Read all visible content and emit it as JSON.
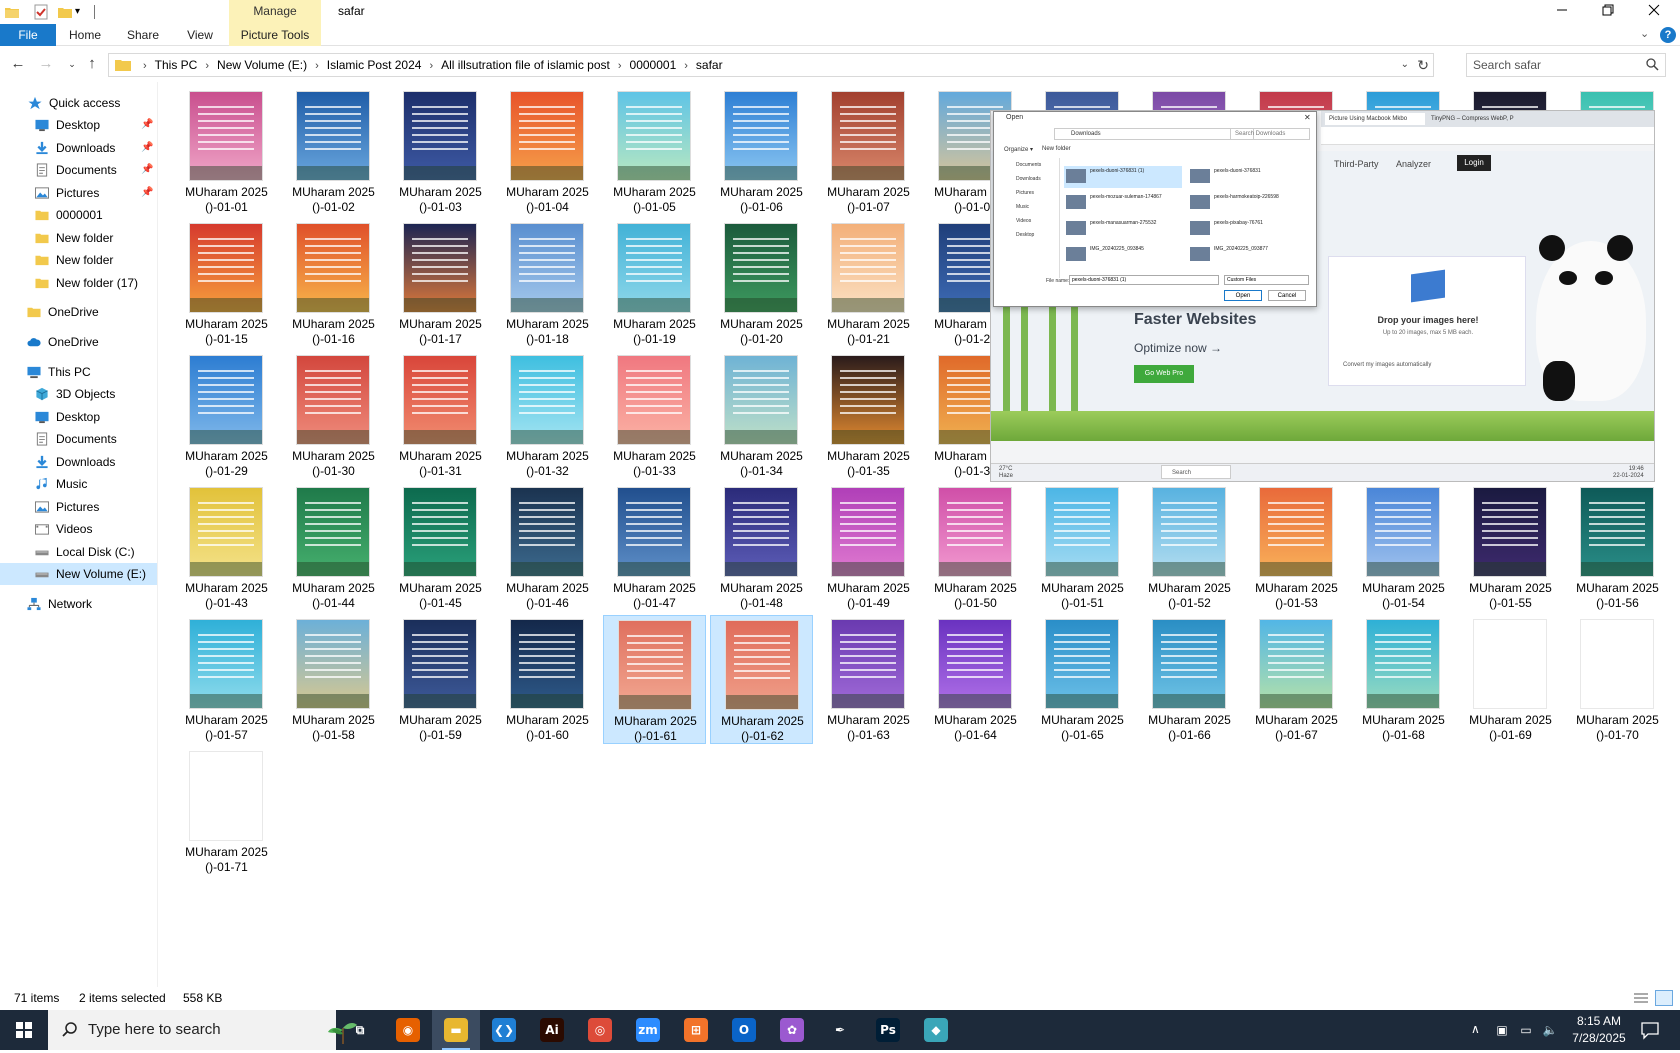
{
  "window": {
    "title": "safar",
    "context_tab_header": "Manage",
    "min_icon": "minimize-icon",
    "max_icon": "restore-icon",
    "close_icon": "close-icon"
  },
  "ribbon": {
    "tabs": [
      "File",
      "Home",
      "Share",
      "View",
      "Picture Tools"
    ]
  },
  "address": {
    "crumbs": [
      "This PC",
      "New Volume (E:)",
      "Islamic Post 2024",
      "All illsutration file of islamic post",
      "0000001",
      "safar"
    ],
    "search_placeholder": "Search safar"
  },
  "sidebar": {
    "items": [
      {
        "label": "Quick access",
        "icon": "star-icon",
        "pinned": false
      },
      {
        "label": "Desktop",
        "icon": "desktop-icon",
        "pinned": true
      },
      {
        "label": "Downloads",
        "icon": "download-icon",
        "pinned": true
      },
      {
        "label": "Documents",
        "icon": "documents-icon",
        "pinned": true
      },
      {
        "label": "Pictures",
        "icon": "pictures-icon",
        "pinned": true
      },
      {
        "label": "0000001",
        "icon": "folder-icon",
        "pinned": false
      },
      {
        "label": "New folder",
        "icon": "folder-icon",
        "pinned": false
      },
      {
        "label": "New folder",
        "icon": "folder-icon",
        "pinned": false
      },
      {
        "label": "New folder (17)",
        "icon": "folder-icon",
        "pinned": false
      },
      {
        "label": "OneDrive",
        "icon": "folder-icon",
        "pinned": false
      },
      {
        "label": "OneDrive",
        "icon": "cloud-icon",
        "pinned": false
      },
      {
        "label": "This PC",
        "icon": "computer-icon",
        "pinned": false
      },
      {
        "label": "3D Objects",
        "icon": "cube-icon",
        "pinned": false
      },
      {
        "label": "Desktop",
        "icon": "desktop-icon",
        "pinned": false
      },
      {
        "label": "Documents",
        "icon": "documents-icon",
        "pinned": false
      },
      {
        "label": "Downloads",
        "icon": "download-icon",
        "pinned": false
      },
      {
        "label": "Music",
        "icon": "music-icon",
        "pinned": false
      },
      {
        "label": "Pictures",
        "icon": "pictures-icon",
        "pinned": false
      },
      {
        "label": "Videos",
        "icon": "videos-icon",
        "pinned": false
      },
      {
        "label": "Local Disk (C:)",
        "icon": "drive-icon",
        "pinned": false
      },
      {
        "label": "New Volume (E:)",
        "icon": "drive-icon",
        "pinned": false,
        "selected": true
      },
      {
        "label": "Network",
        "icon": "network-icon",
        "pinned": false
      }
    ],
    "pin_glyph": "📌"
  },
  "files": [
    {
      "line1": "MUharam 2025",
      "line2": "()-01-01",
      "colors": [
        "#c94f8e",
        "#f0a6c8"
      ]
    },
    {
      "line1": "MUharam 2025",
      "line2": "()-01-02",
      "colors": [
        "#1f5da8",
        "#6aa7de"
      ]
    },
    {
      "line1": "MUharam 2025",
      "line2": "()-01-03",
      "colors": [
        "#1d2f6b",
        "#3e5aa5"
      ]
    },
    {
      "line1": "MUharam 2025",
      "line2": "()-01-04",
      "colors": [
        "#e8542b",
        "#f6a04a"
      ]
    },
    {
      "line1": "MUharam 2025",
      "line2": "()-01-05",
      "colors": [
        "#5fc4e6",
        "#b9e8c0"
      ]
    },
    {
      "line1": "MUharam 2025",
      "line2": "()-01-06",
      "colors": [
        "#2e7fd4",
        "#8cc7f2"
      ]
    },
    {
      "line1": "MUharam 2025",
      "line2": "()-01-07",
      "colors": [
        "#a2402f",
        "#d9876b"
      ]
    },
    {
      "line1": "MUharam 2025",
      "line2": "()-01-08",
      "colors": [
        "#63a9dc",
        "#d7c59a"
      ]
    },
    {
      "line1": "",
      "line2": "",
      "colors": [
        "#3d5a9a",
        "#6b84c2"
      ]
    },
    {
      "line1": "",
      "line2": "",
      "colors": [
        "#7b4aa5",
        "#b07bd0"
      ]
    },
    {
      "line1": "",
      "line2": "",
      "colors": [
        "#c23a4a",
        "#e0707f"
      ]
    },
    {
      "line1": "",
      "line2": "",
      "colors": [
        "#2c9cd8",
        "#7fd0f0"
      ]
    },
    {
      "line1": "",
      "line2": "",
      "colors": [
        "#1b1b2e",
        "#3a3a58"
      ]
    },
    {
      "line1": "",
      "line2": "",
      "colors": [
        "#39c0b0",
        "#8fe0d3"
      ]
    },
    {
      "line1": "MUharam 2025",
      "line2": "()-01-15",
      "colors": [
        "#d63a2e",
        "#f7a03c"
      ]
    },
    {
      "line1": "MUharam 2025",
      "line2": "()-01-16",
      "colors": [
        "#e0502a",
        "#f8b64a"
      ]
    },
    {
      "line1": "MUharam 2025",
      "line2": "()-01-17",
      "colors": [
        "#1d2553",
        "#e07a3a"
      ]
    },
    {
      "line1": "MUharam 2025",
      "line2": "()-01-18",
      "colors": [
        "#5a8fd0",
        "#a5c9ec"
      ]
    },
    {
      "line1": "MUharam 2025",
      "line2": "()-01-19",
      "colors": [
        "#42b2d7",
        "#8fd8ea"
      ]
    },
    {
      "line1": "MUharam 2025",
      "line2": "()-01-20",
      "colors": [
        "#1c5b3c",
        "#3d9a5f"
      ]
    },
    {
      "line1": "MUharam 2025",
      "line2": "()-01-21",
      "colors": [
        "#f3b07a",
        "#fbe0c2"
      ]
    },
    {
      "line1": "MUharam 2025",
      "line2": "()-01-22",
      "colors": [
        "#203f7a",
        "#3d6bb5"
      ]
    },
    {
      "line1": "",
      "line2": "",
      "colors": [
        "#000000",
        "#000000"
      ],
      "hidden": true
    },
    {
      "line1": "",
      "line2": "",
      "colors": [
        "#000000",
        "#000000"
      ],
      "hidden": true
    },
    {
      "line1": "",
      "line2": "",
      "colors": [
        "#000000",
        "#000000"
      ],
      "hidden": true
    },
    {
      "line1": "",
      "line2": "",
      "colors": [
        "#000000",
        "#000000"
      ],
      "hidden": true
    },
    {
      "line1": "",
      "line2": "",
      "colors": [
        "#000000",
        "#000000"
      ],
      "hidden": true
    },
    {
      "line1": "",
      "line2": "",
      "colors": [
        "#000000",
        "#000000"
      ],
      "hidden": true
    },
    {
      "line1": "MUharam 2025",
      "line2": "()-01-29",
      "colors": [
        "#2d7dd2",
        "#7fb8ea"
      ]
    },
    {
      "line1": "MUharam 2025",
      "line2": "()-01-30",
      "colors": [
        "#d3473d",
        "#ef8c7c"
      ]
    },
    {
      "line1": "MUharam 2025",
      "line2": "()-01-31",
      "colors": [
        "#d9463a",
        "#f18c70"
      ]
    },
    {
      "line1": "MUharam 2025",
      "line2": "()-01-32",
      "colors": [
        "#3fbfe0",
        "#a4e4f2"
      ]
    },
    {
      "line1": "MUharam 2025",
      "line2": "()-01-33",
      "colors": [
        "#f07880",
        "#fbb2a4"
      ]
    },
    {
      "line1": "MUharam 2025",
      "line2": "()-01-34",
      "colors": [
        "#6fb3d5",
        "#bfe0c8"
      ]
    },
    {
      "line1": "MUharam 2025",
      "line2": "()-01-35",
      "colors": [
        "#2a1b1b",
        "#e28a30"
      ]
    },
    {
      "line1": "MUharam 2025",
      "line2": "()-01-36",
      "colors": [
        "#e06a2a",
        "#f0b050"
      ]
    },
    {
      "line1": "",
      "line2": "",
      "colors": [
        "#000000",
        "#000000"
      ],
      "hidden": true
    },
    {
      "line1": "",
      "line2": "",
      "colors": [
        "#000000",
        "#000000"
      ],
      "hidden": true
    },
    {
      "line1": "",
      "line2": "",
      "colors": [
        "#000000",
        "#000000"
      ],
      "hidden": true
    },
    {
      "line1": "",
      "line2": "",
      "colors": [
        "#000000",
        "#000000"
      ],
      "hidden": true
    },
    {
      "line1": "",
      "line2": "",
      "colors": [
        "#000000",
        "#000000"
      ],
      "hidden": true
    },
    {
      "line1": "",
      "line2": "",
      "colors": [
        "#000000",
        "#000000"
      ],
      "hidden": true
    },
    {
      "line1": "MUharam 2025",
      "line2": "()-01-43",
      "colors": [
        "#e2c23a",
        "#f4e28a"
      ]
    },
    {
      "line1": "MUharam 2025",
      "line2": "()-01-44",
      "colors": [
        "#1f7a4a",
        "#46b06e"
      ]
    },
    {
      "line1": "MUharam 2025",
      "line2": "()-01-45",
      "colors": [
        "#0d6a4e",
        "#2aa07a"
      ]
    },
    {
      "line1": "MUharam 2025",
      "line2": "()-01-46",
      "colors": [
        "#1b3350",
        "#3c6a8e"
      ]
    },
    {
      "line1": "MUharam 2025",
      "line2": "()-01-47",
      "colors": [
        "#214f8e",
        "#5e8fc8"
      ]
    },
    {
      "line1": "MUharam 2025",
      "line2": "()-01-48",
      "colors": [
        "#2b2b7a",
        "#5d5db8"
      ]
    },
    {
      "line1": "MUharam 2025",
      "line2": "()-01-49",
      "colors": [
        "#b03fb8",
        "#e07ad0"
      ]
    },
    {
      "line1": "MUharam 2025",
      "line2": "()-01-50",
      "colors": [
        "#d04fa8",
        "#f29ad0"
      ]
    },
    {
      "line1": "MUharam 2025",
      "line2": "()-01-51",
      "colors": [
        "#4cb6e6",
        "#a6dcf2"
      ]
    },
    {
      "line1": "MUharam 2025",
      "line2": "()-01-52",
      "colors": [
        "#58b2e0",
        "#b4def0"
      ]
    },
    {
      "line1": "MUharam 2025",
      "line2": "()-01-53",
      "colors": [
        "#e96a3a",
        "#f9b25a"
      ]
    },
    {
      "line1": "MUharam 2025",
      "line2": "()-01-54",
      "colors": [
        "#4a86d8",
        "#a0c2ee"
      ]
    },
    {
      "line1": "MUharam 2025",
      "line2": "()-01-55",
      "colors": [
        "#1a1a40",
        "#3e2a6e"
      ]
    },
    {
      "line1": "MUharam 2025",
      "line2": "()-01-56",
      "colors": [
        "#0e5a58",
        "#2a8e88"
      ]
    },
    {
      "line1": "MUharam 2025",
      "line2": "()-01-57",
      "colors": [
        "#2fb0d8",
        "#8fdcec"
      ]
    },
    {
      "line1": "MUharam 2025",
      "line2": "()-01-58",
      "colors": [
        "#6cb0d8",
        "#d8c890"
      ]
    },
    {
      "line1": "MUharam 2025",
      "line2": "()-01-59",
      "colors": [
        "#1a2e5a",
        "#3e5a9a"
      ]
    },
    {
      "line1": "MUharam 2025",
      "line2": "()-01-60",
      "colors": [
        "#14284a",
        "#2e5a8a"
      ]
    },
    {
      "line1": "MUharam 2025",
      "line2": "()-01-61",
      "colors": [
        "#e0705e",
        "#f2a892"
      ],
      "selected": true
    },
    {
      "line1": "MUharam 2025",
      "line2": "()-01-62",
      "colors": [
        "#e06c5a",
        "#f0a08a"
      ],
      "selected": true
    },
    {
      "line1": "MUharam 2025",
      "line2": "()-01-63",
      "colors": [
        "#6a3ab0",
        "#a06ad8"
      ]
    },
    {
      "line1": "MUharam 2025",
      "line2": "()-01-64",
      "colors": [
        "#6a32c0",
        "#b070e8"
      ]
    },
    {
      "line1": "MUharam 2025",
      "line2": "()-01-65",
      "colors": [
        "#2a8ec8",
        "#6cc0e8"
      ]
    },
    {
      "line1": "MUharam 2025",
      "line2": "()-01-66",
      "colors": [
        "#2a8ec4",
        "#70c4e6"
      ]
    },
    {
      "line1": "MUharam 2025",
      "line2": "()-01-67",
      "colors": [
        "#52b6e6",
        "#b6e2a8"
      ]
    },
    {
      "line1": "MUharam 2025",
      "line2": "()-01-68",
      "colors": [
        "#2eb0d6",
        "#9adcc0"
      ]
    },
    {
      "line1": "MUharam 2025",
      "line2": "()-01-69",
      "colors": [
        "#ffffff",
        "#ffffff"
      ],
      "blank": true
    },
    {
      "line1": "MUharam 2025",
      "line2": "()-01-70",
      "colors": [
        "#ffffff",
        "#ffffff"
      ],
      "blank": true
    },
    {
      "line1": "MUharam 2025",
      "line2": "()-01-71",
      "colors": [
        "#ffffff",
        "#ffffff"
      ],
      "blank": true
    }
  ],
  "overlay": {
    "dialog_title": "Open",
    "dialog_path": "Downloads",
    "dialog_search": "Search Downloads",
    "dialog_organize": "Organize ▾",
    "dialog_newfolder": "New folder",
    "dialog_side": [
      "Documents",
      "Downloads",
      "Pictures",
      "Music",
      "Videos",
      "Desktop"
    ],
    "dialog_files": [
      "pexels-duoni-376831 (1)",
      "pexels-duoni-376831",
      "pexels-mozuar-suleman-174867",
      "pexels-harmokeatoip-226598",
      "pexels-manasuarman-275532",
      "pexels-pixabay-76761",
      "IMG_20240225_093845",
      "IMG_20240225_093877"
    ],
    "dialog_filename_label": "File name:",
    "dialog_filename": "pexels-duoni-376831 (1)",
    "dialog_filetype": "Custom Files",
    "dialog_open": "Open",
    "dialog_cancel": "Cancel",
    "tab1": "Picture Using Macbook Mkbo",
    "tab2": "TinyPNG – Compress WebP, P",
    "nav_a": "Third-Party",
    "nav_b": "Analyzer",
    "login": "Login",
    "headline": "Faster Websites",
    "optimize": "Optimize now →",
    "gopro": "Go Web Pro",
    "drop_title": "Drop your images here!",
    "drop_sub": "Up to 20 images, max 5 MB each.",
    "convert": "Convert my images automatically",
    "weather_temp": "27°C",
    "weather_desc": "Haze",
    "taskbar_search": "Search",
    "clock_time": "19:46",
    "clock_date": "22-01-2024"
  },
  "status": {
    "count": "71 items",
    "selected": "2 items selected",
    "size": "558 KB"
  },
  "taskbar": {
    "search_placeholder": "Type here to search",
    "time": "8:15 AM",
    "date": "7/28/2025",
    "apps": [
      {
        "name": "task-view",
        "glyph": "⧉",
        "bg": "transparent"
      },
      {
        "name": "firefox",
        "glyph": "◉",
        "bg": "#e66000"
      },
      {
        "name": "file-explorer",
        "glyph": "▬",
        "bg": "#e8b730",
        "active": true
      },
      {
        "name": "vscode",
        "glyph": "❮❯",
        "bg": "#1f7fd4"
      },
      {
        "name": "illustrator",
        "glyph": "Ai",
        "bg": "#2b0a00"
      },
      {
        "name": "chrome",
        "glyph": "◎",
        "bg": "#dd4b39"
      },
      {
        "name": "zoom",
        "glyph": "zm",
        "bg": "#2d8cff"
      },
      {
        "name": "xampp",
        "glyph": "⊞",
        "bg": "#f2732a"
      },
      {
        "name": "outlook",
        "glyph": "O",
        "bg": "#0a64c8"
      },
      {
        "name": "paint",
        "glyph": "✿",
        "bg": "#9b59d0"
      },
      {
        "name": "pen-tool",
        "glyph": "✒",
        "bg": "transparent"
      },
      {
        "name": "photoshop",
        "glyph": "Ps",
        "bg": "#001e36"
      },
      {
        "name": "app-diamond",
        "glyph": "◆",
        "bg": "#3aa6b8"
      }
    ]
  }
}
